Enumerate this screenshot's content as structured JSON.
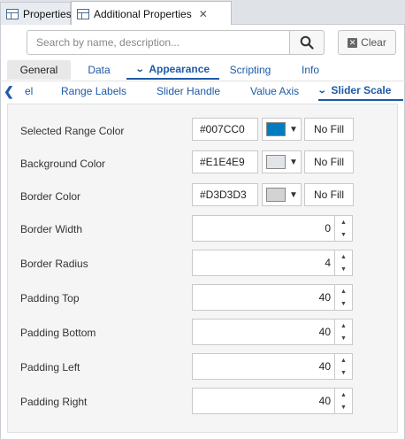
{
  "view_tabs": [
    {
      "label": "Properties"
    },
    {
      "label": "Additional Properties"
    }
  ],
  "search": {
    "placeholder": "Search by name, description...",
    "value": ""
  },
  "clear_label": "Clear",
  "main_tabs": [
    {
      "label": "General"
    },
    {
      "label": "Data"
    },
    {
      "label": "Appearance"
    },
    {
      "label": "Scripting"
    },
    {
      "label": "Info"
    }
  ],
  "sub_tabs": [
    {
      "label": "el"
    },
    {
      "label": "Range Labels"
    },
    {
      "label": "Slider Handle"
    },
    {
      "label": "Value Axis"
    },
    {
      "label": "Slider Scale"
    }
  ],
  "colors": {
    "accent": "#1e5aa8",
    "selected_range": "#007CC0",
    "background": "#E1E4E9",
    "border": "#D3D3D3"
  },
  "color_rows": [
    {
      "label": "Selected Range Color",
      "value": "#007CC0",
      "no_fill": "No Fill"
    },
    {
      "label": "Background Color",
      "value": "#E1E4E9",
      "no_fill": "No Fill"
    },
    {
      "label": "Border Color",
      "value": "#D3D3D3",
      "no_fill": "No Fill"
    }
  ],
  "number_rows": [
    {
      "label": "Border Width",
      "value": "0"
    },
    {
      "label": "Border Radius",
      "value": "4"
    },
    {
      "label": "Padding Top",
      "value": "40"
    },
    {
      "label": "Padding Bottom",
      "value": "40"
    },
    {
      "label": "Padding Left",
      "value": "40"
    },
    {
      "label": "Padding Right",
      "value": "40"
    }
  ]
}
